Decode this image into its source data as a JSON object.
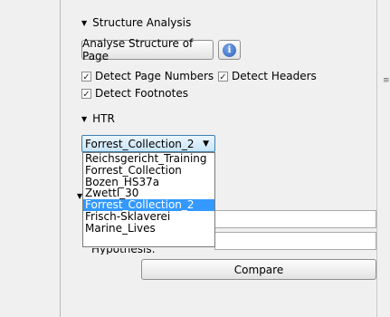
{
  "structure_analysis": {
    "heading": "Structure Analysis",
    "analyse_button": "Analyse Structure of Page",
    "checkboxes": [
      {
        "label": "Detect Page Numbers",
        "checked": true
      },
      {
        "label": "Detect Headers",
        "checked": true
      },
      {
        "label": "Detect Footnotes",
        "checked": true
      }
    ]
  },
  "htr": {
    "heading": "HTR",
    "selected_model": "Forrest_Collection_2",
    "options": [
      "Reichsgericht_Training",
      "Forrest_Collection",
      "Bozen_HS37a",
      "Zwettl_30",
      "Forrest_Collection_2",
      "Frisch-Sklaverei",
      "Marine_Lives"
    ],
    "selected_index": 4
  },
  "partial_label": "Hypothesis:",
  "compare_button": "Compare",
  "colors": {
    "selection": "#3399ff",
    "combo_border": "#3c7fb1"
  }
}
